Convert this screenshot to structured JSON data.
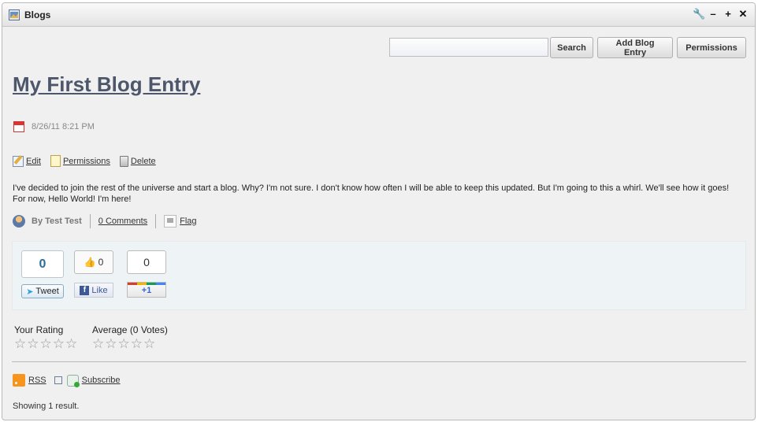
{
  "window": {
    "title": "Blogs",
    "controls": [
      "wrench-icon",
      "minimize-icon",
      "maximize-icon",
      "close-icon"
    ]
  },
  "toolbar": {
    "search_value": "",
    "search_label": "Search",
    "add_label": "Add Blog Entry",
    "permissions_label": "Permissions"
  },
  "entry": {
    "title": "My First Blog Entry",
    "date": "8/26/11 8:21 PM",
    "actions": {
      "edit": "Edit",
      "permissions": "Permissions",
      "delete": "Delete"
    },
    "body": "I've decided to join the rest of the universe and start a blog. Why? I'm not sure. I don't know how often I will be able to keep this updated. But I'm going to this a whirl. We'll see how it goes! For now, Hello World!  I'm here!",
    "author": "By Test Test",
    "comments": "0 Comments",
    "flag": "Flag"
  },
  "social": {
    "tweet_count": "0",
    "tweet_label": "Tweet",
    "like_count": "0",
    "like_label": "Like",
    "plusone_count": "0",
    "plusone_label": "+1"
  },
  "ratings": {
    "your_label": "Your Rating",
    "average_label": "Average (0 Votes)",
    "your_value": 0,
    "average_value": 0,
    "max": 5
  },
  "feeds": {
    "rss": "RSS",
    "subscribe": "Subscribe"
  },
  "footer": {
    "result": "Showing 1 result."
  },
  "colors": {
    "title": "#4d566a",
    "panel": "#f0f0f0",
    "social_bg": "#eef3f6"
  }
}
